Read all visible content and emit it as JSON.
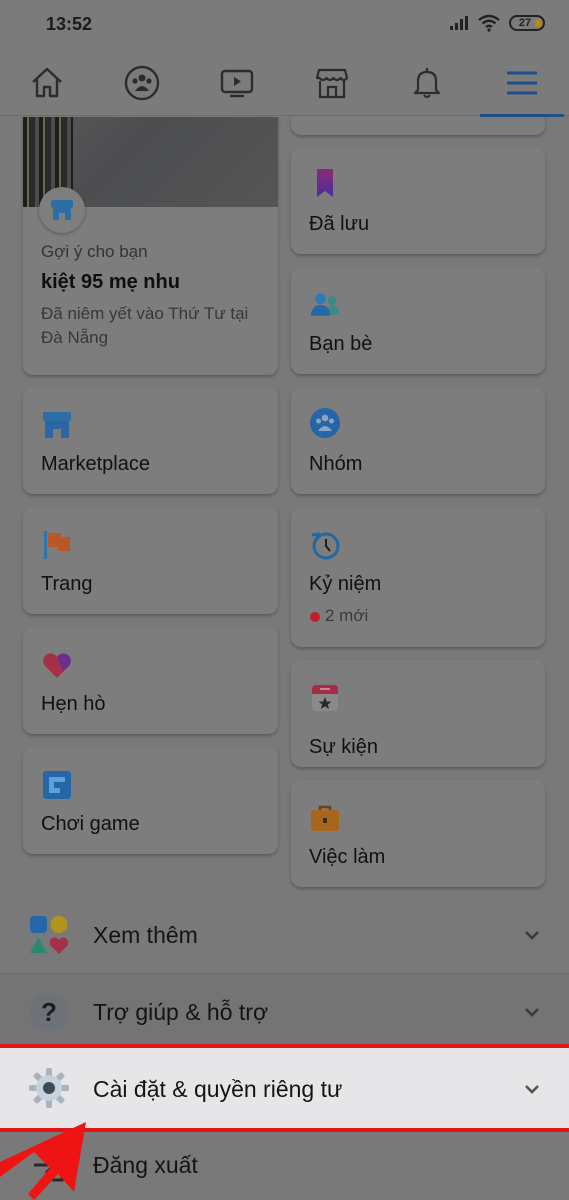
{
  "status_bar": {
    "time": "13:52",
    "battery": "27",
    "icons": [
      "signal-icon",
      "wifi-icon",
      "battery-icon"
    ]
  },
  "top_nav": {
    "tabs": [
      {
        "name": "home",
        "icon": "home-icon"
      },
      {
        "name": "groups",
        "icon": "groups-icon"
      },
      {
        "name": "watch",
        "icon": "video-icon"
      },
      {
        "name": "marketplace",
        "icon": "store-icon"
      },
      {
        "name": "notifications",
        "icon": "bell-icon"
      },
      {
        "name": "menu",
        "icon": "hamburger-icon",
        "active": true
      }
    ]
  },
  "featured": {
    "kicker": "Gợi ý cho bạn",
    "title": "kiệt 95 mẹ nhu",
    "subtitle": "Đã niêm yết vào Thứ Tư tại Đà Nẵng"
  },
  "shortcuts_left": [
    {
      "label": "Marketplace",
      "icon": "store-icon"
    },
    {
      "label": "Trang",
      "icon": "flag-icon"
    },
    {
      "label": "Hẹn hò",
      "icon": "heart-icon"
    },
    {
      "label": "Chơi game",
      "icon": "gaming-icon"
    }
  ],
  "shortcuts_right": [
    {
      "label": "Đã lưu",
      "icon": "bookmark-icon"
    },
    {
      "label": "Bạn bè",
      "icon": "friends-icon"
    },
    {
      "label": "Nhóm",
      "icon": "groups-icon"
    },
    {
      "label": "Kỷ niệm",
      "icon": "memories-icon",
      "badge": "2 mới"
    },
    {
      "label": "Sự kiện",
      "icon": "calendar-icon"
    },
    {
      "label": "Việc làm",
      "icon": "briefcase-icon"
    }
  ],
  "menu_rows": [
    {
      "label": "Xem thêm",
      "icon": "see-more-icon"
    },
    {
      "label": "Trợ giúp & hỗ trợ",
      "icon": "help-icon"
    },
    {
      "label": "Cài đặt & quyền riêng tư",
      "icon": "gear-icon",
      "highlighted": true
    },
    {
      "label": "Đăng xuất",
      "icon": "logout-icon"
    }
  ],
  "colors": {
    "overlay_bg": "#797979",
    "highlight": "#e31414",
    "accent": "#1f4e8a",
    "badge_dot": "#c41e2a"
  }
}
